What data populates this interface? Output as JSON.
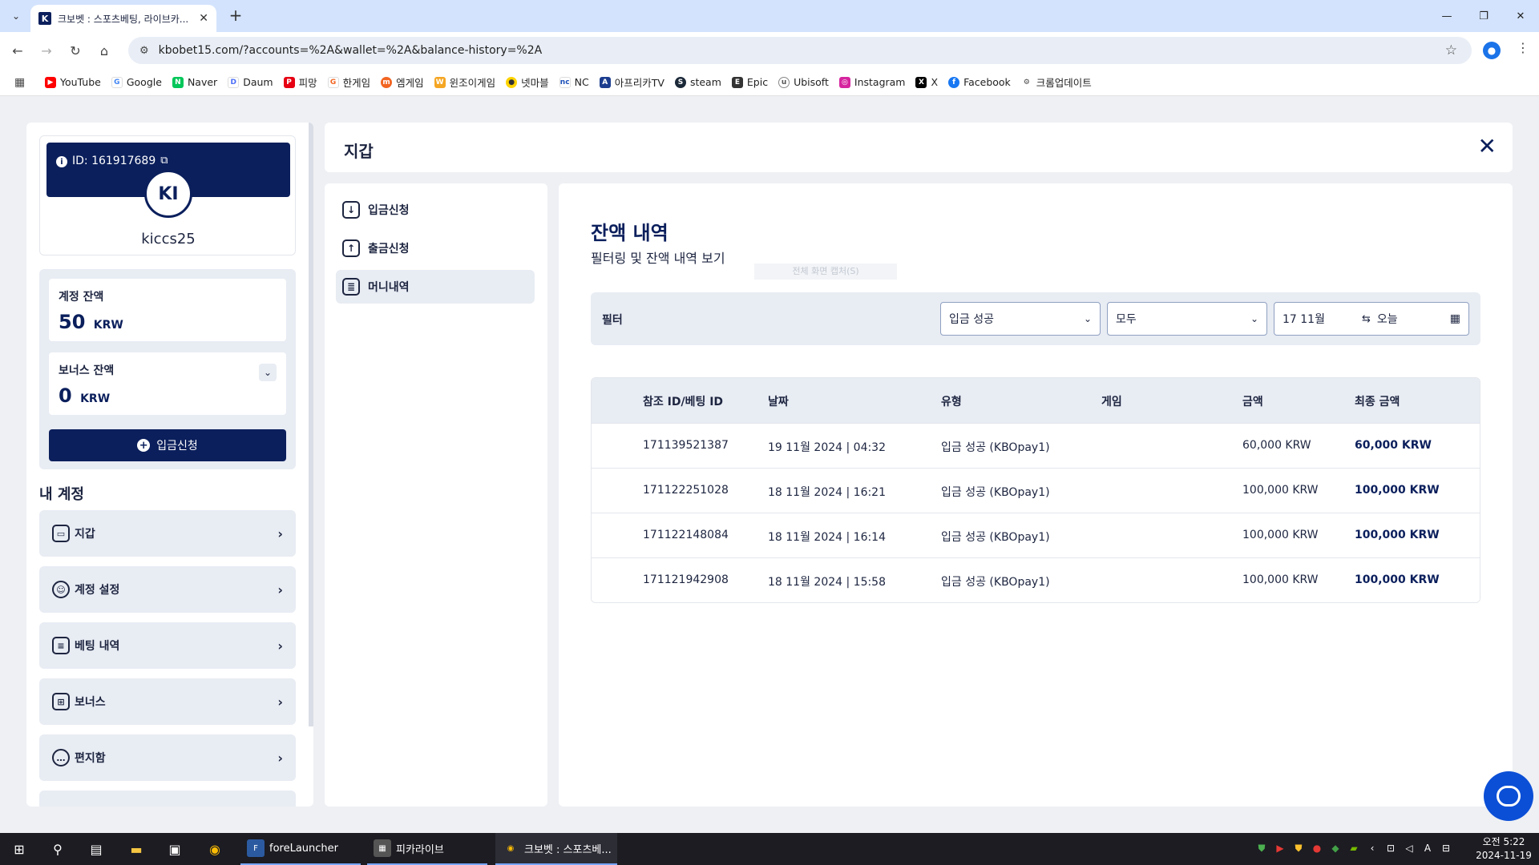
{
  "browser": {
    "tab_title": "크보벳 : 스포츠베팅, 라이브카...",
    "url": "kbobet15.com/?accounts=%2A&wallet=%2A&balance-history=%2A",
    "bookmarks": [
      "YouTube",
      "Google",
      "Naver",
      "Daum",
      "피망",
      "한게임",
      "엠게임",
      "윈조이게임",
      "넷마블",
      "NC",
      "아프리카TV",
      "steam",
      "Epic",
      "Ubisoft",
      "Instagram",
      "X",
      "Facebook",
      "크롬업데이트"
    ]
  },
  "user": {
    "id_label": "ID: 161917689",
    "initials": "KI",
    "username": "kiccs25"
  },
  "balances": {
    "account_label": "계정 잔액",
    "account_value": "50",
    "bonus_label": "보너스 잔액",
    "bonus_value": "0",
    "currency": "KRW",
    "deposit_button": "입금신청"
  },
  "my_account": {
    "title": "내 계정",
    "items": [
      "지갑",
      "계정 설정",
      "베팅 내역",
      "보너스",
      "편지함"
    ]
  },
  "wallet": {
    "title": "지갑",
    "nav": [
      "입금신청",
      "출금신청",
      "머니내역"
    ]
  },
  "history": {
    "title": "잔액 내역",
    "subtitle": "필터링 및 잔액 내역 보기",
    "ghost_text": "전체 화면 캡처(S)",
    "filter_label": "필터",
    "filter_type": "입금 성공",
    "filter_game": "모두",
    "date_from": "17 11월",
    "date_to": "오늘",
    "columns": [
      "참조 ID/베팅 ID",
      "날짜",
      "유형",
      "게임",
      "금액",
      "최종 금액"
    ],
    "rows": [
      {
        "ref": "171139521387",
        "date": "19 11월 2024 | 04:32",
        "type": "입금 성공 (KBOpay1)",
        "game": "",
        "amount": "60,000 KRW",
        "final": "60,000 KRW"
      },
      {
        "ref": "171122251028",
        "date": "18 11월 2024 | 16:21",
        "type": "입금 성공 (KBOpay1)",
        "game": "",
        "amount": "100,000 KRW",
        "final": "100,000 KRW"
      },
      {
        "ref": "171122148084",
        "date": "18 11월 2024 | 16:14",
        "type": "입금 성공 (KBOpay1)",
        "game": "",
        "amount": "100,000 KRW",
        "final": "100,000 KRW"
      },
      {
        "ref": "171121942908",
        "date": "18 11월 2024 | 15:58",
        "type": "입금 성공 (KBOpay1)",
        "game": "",
        "amount": "100,000 KRW",
        "final": "100,000 KRW"
      }
    ]
  },
  "taskbar": {
    "apps": [
      "foreLauncher",
      "피카라이브",
      "크보벳 : 스포츠베..."
    ],
    "time": "오전 5:22",
    "date": "2024-11-19"
  },
  "colors": {
    "brand": "#0b1f5c",
    "panel_gray": "#e8ecf3",
    "chat": "#0b4fd6"
  }
}
